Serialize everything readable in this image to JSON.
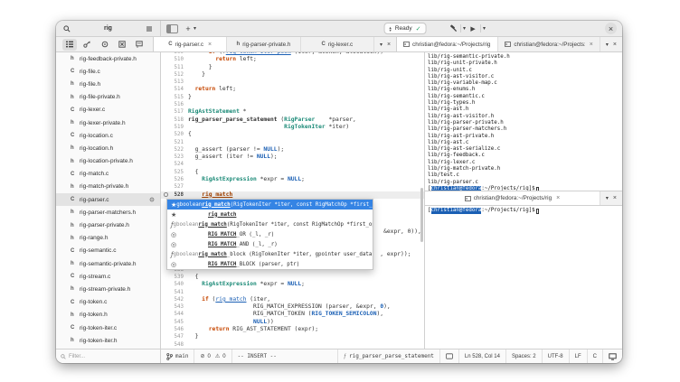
{
  "window": {
    "title": "rig"
  },
  "headerbar": {
    "ready_label": "Ready",
    "new_tab_label": "+"
  },
  "sidebar": {
    "panel_icons": [
      "project-tree",
      "symbols",
      "build-pipeline",
      "todo",
      "comments"
    ],
    "filter_placeholder": "Filter...",
    "files": [
      {
        "t": "h",
        "n": "rig-feedback-private.h"
      },
      {
        "t": "C",
        "n": "rig-file.c"
      },
      {
        "t": "h",
        "n": "rig-file.h"
      },
      {
        "t": "h",
        "n": "rig-file-private.h"
      },
      {
        "t": "C",
        "n": "rig-lexer.c"
      },
      {
        "t": "h",
        "n": "rig-lexer-private.h"
      },
      {
        "t": "C",
        "n": "rig-location.c"
      },
      {
        "t": "h",
        "n": "rig-location.h"
      },
      {
        "t": "h",
        "n": "rig-location-private.h"
      },
      {
        "t": "C",
        "n": "rig-match.c"
      },
      {
        "t": "h",
        "n": "rig-match-private.h"
      },
      {
        "t": "C",
        "n": "rig-parser.c",
        "sel": true,
        "gear": true
      },
      {
        "t": "h",
        "n": "rig-parser-matchers.h"
      },
      {
        "t": "h",
        "n": "rig-parser-private.h"
      },
      {
        "t": "h",
        "n": "rig-range.h"
      },
      {
        "t": "C",
        "n": "rig-semantic.c"
      },
      {
        "t": "h",
        "n": "rig-semantic-private.h"
      },
      {
        "t": "C",
        "n": "rig-stream.c"
      },
      {
        "t": "h",
        "n": "rig-stream-private.h"
      },
      {
        "t": "C",
        "n": "rig-token.c"
      },
      {
        "t": "h",
        "n": "rig-token.h"
      },
      {
        "t": "C",
        "n": "rig-token-iter.c"
      },
      {
        "t": "h",
        "n": "rig-token-iter.h"
      }
    ]
  },
  "editor": {
    "tabs": [
      {
        "icon": "C",
        "label": "rig-parser.c",
        "active": true,
        "close": true
      },
      {
        "icon": "h",
        "label": "rig-parser-private.h",
        "active": false,
        "close": false
      },
      {
        "icon": "C",
        "label": "rig-lexer.c",
        "active": false,
        "close": false
      }
    ],
    "lines": [
      {
        "n": 509,
        "toks": [
          [
            "pl",
            "      "
          ],
          [
            "kw",
            "if"
          ],
          [
            "pl",
            " (!"
          ],
          [
            "lnk",
            "rig_token_iter_peek"
          ],
          [
            "pl",
            " (iter, &token, &location))"
          ]
        ]
      },
      {
        "n": 510,
        "toks": [
          [
            "pl",
            "        "
          ],
          [
            "kw",
            "return"
          ],
          [
            "pl",
            " left;"
          ]
        ]
      },
      {
        "n": 511,
        "toks": [
          [
            "pl",
            "      }"
          ]
        ]
      },
      {
        "n": 512,
        "toks": [
          [
            "pl",
            "    }"
          ]
        ]
      },
      {
        "n": 513,
        "toks": []
      },
      {
        "n": 514,
        "toks": [
          [
            "pl",
            "  "
          ],
          [
            "kw",
            "return"
          ],
          [
            "pl",
            " left;"
          ]
        ]
      },
      {
        "n": 515,
        "toks": [
          [
            "pl",
            "}"
          ]
        ]
      },
      {
        "n": 516,
        "toks": []
      },
      {
        "n": 517,
        "toks": [
          [
            "ty",
            "RigAstStatement"
          ],
          [
            "pl",
            " *"
          ]
        ]
      },
      {
        "n": 518,
        "toks": [
          [
            "fn",
            "rig_parser_parse_statement"
          ],
          [
            "pl",
            " ("
          ],
          [
            "ty",
            "RigParser"
          ],
          [
            "pl",
            "    *parser,"
          ]
        ]
      },
      {
        "n": 519,
        "toks": [
          [
            "pl",
            "                            "
          ],
          [
            "ty",
            "RigTokenIter"
          ],
          [
            "pl",
            " *iter)"
          ]
        ]
      },
      {
        "n": 520,
        "toks": [
          [
            "pl",
            "{"
          ]
        ]
      },
      {
        "n": 521,
        "toks": []
      },
      {
        "n": 522,
        "toks": [
          [
            "pl",
            "  g_assert (parser != "
          ],
          [
            "ct",
            "NULL"
          ],
          [
            "pl",
            ");"
          ]
        ]
      },
      {
        "n": 523,
        "toks": [
          [
            "pl",
            "  g_assert (iter != "
          ],
          [
            "ct",
            "NULL"
          ],
          [
            "pl",
            ");"
          ]
        ]
      },
      {
        "n": 524,
        "toks": []
      },
      {
        "n": 525,
        "toks": [
          [
            "pl",
            "  {"
          ]
        ]
      },
      {
        "n": 526,
        "toks": [
          [
            "pl",
            "    "
          ],
          [
            "ty",
            "RigAstExpression"
          ],
          [
            "pl",
            " *expr = "
          ],
          [
            "ct",
            "NULL"
          ],
          [
            "pl",
            ";"
          ]
        ]
      },
      {
        "n": 527,
        "toks": []
      },
      {
        "n": 528,
        "cur": true,
        "diag": true,
        "toks": [
          [
            "pl",
            "    "
          ],
          [
            "err",
            "rig_match"
          ]
        ]
      },
      {
        "n": 529,
        "toks": []
      },
      {
        "n": 530,
        "toks": []
      },
      {
        "n": 531,
        "toks": []
      },
      {
        "n": 532,
        "toks": []
      },
      {
        "n": 533,
        "toks": [
          [
            "pl",
            "                                                         &expr, 0)),"
          ]
        ]
      },
      {
        "n": 534,
        "toks": []
      },
      {
        "n": 535,
        "toks": []
      },
      {
        "n": 536,
        "toks": [
          [
            "pl",
            "                                                        , expr));"
          ]
        ]
      },
      {
        "n": 537,
        "toks": []
      },
      {
        "n": 538,
        "toks": []
      },
      {
        "n": 539,
        "toks": [
          [
            "pl",
            "  {"
          ]
        ]
      },
      {
        "n": 540,
        "toks": [
          [
            "pl",
            "    "
          ],
          [
            "ty",
            "RigAstExpression"
          ],
          [
            "pl",
            " *expr = "
          ],
          [
            "ct",
            "NULL"
          ],
          [
            "pl",
            ";"
          ]
        ]
      },
      {
        "n": 541,
        "toks": []
      },
      {
        "n": 542,
        "toks": [
          [
            "pl",
            "    "
          ],
          [
            "kw",
            "if"
          ],
          [
            "pl",
            " ("
          ],
          [
            "lnk",
            "rig_match"
          ],
          [
            "pl",
            " (iter,"
          ]
        ]
      },
      {
        "n": 543,
        "toks": [
          [
            "pl",
            "                   RIG_MATCH_EXPRESSION (parser, &expr, "
          ],
          [
            "ct",
            "0"
          ],
          [
            "pl",
            "),"
          ]
        ]
      },
      {
        "n": 544,
        "toks": [
          [
            "pl",
            "                   RIG_MATCH_TOKEN ("
          ],
          [
            "ct",
            "RIG_TOKEN_SEMICOLON"
          ],
          [
            "pl",
            "),"
          ]
        ]
      },
      {
        "n": 545,
        "toks": [
          [
            "pl",
            "                   "
          ],
          [
            "ct",
            "NULL"
          ],
          [
            "pl",
            "))"
          ]
        ]
      },
      {
        "n": 546,
        "toks": [
          [
            "pl",
            "      "
          ],
          [
            "kw",
            "return"
          ],
          [
            "pl",
            " RIG_AST_STATEMENT (expr);"
          ]
        ]
      },
      {
        "n": 547,
        "toks": [
          [
            "pl",
            "  }"
          ]
        ]
      },
      {
        "n": 548,
        "toks": []
      },
      {
        "n": 549,
        "toks": [
          [
            "pl",
            "  {"
          ]
        ]
      }
    ]
  },
  "completion": {
    "rows": [
      {
        "icon": "star",
        "pre": "gboolean",
        "name": "rig_match",
        "post": " (RigTokenIter *iter, const RigMatchOp *first_op, ...)",
        "sel": true
      },
      {
        "icon": "star",
        "pre": "",
        "name": "rig_match",
        "post": ""
      },
      {
        "icon": "func",
        "pre": "gboolean",
        "name": "rig_match",
        "post": " (RigTokenIter *iter, const RigMatchOp *first_op, ...)"
      },
      {
        "icon": "macro",
        "pre": "",
        "name": "RIG_MATCH",
        "post": "_OR (_l, _r)"
      },
      {
        "icon": "macro",
        "pre": "",
        "name": "RIG_MATCH",
        "post": "_AND (_l, _r)"
      },
      {
        "icon": "func",
        "pre": "gboolean",
        "name": "rig_match",
        "post": "_block (RigTokenIter *iter, gpointer user_data)"
      },
      {
        "icon": "macro",
        "pre": "",
        "name": "RIG_MATCH",
        "post": "_BLOCK (parser, ptr)"
      }
    ]
  },
  "terminal_panel": {
    "tabs_top": [
      {
        "label": "christian@fedora:~/Projects/rig",
        "active": true,
        "close": false
      },
      {
        "label": "christian@fedora:~/Projects:",
        "active": false,
        "close": true
      }
    ],
    "tab_bottom": {
      "label": "christian@fedora:~/Projects/rig",
      "close": true
    },
    "term1_lines": [
      "lib/rig-semantic-private.h",
      "lib/rig-unit-private.h",
      "lib/rig-unit.c",
      "lib/rig-ast-visitor.c",
      "lib/rig-variable-map.c",
      "lib/rig-enums.h",
      "lib/rig-semantic.c",
      "lib/rig-types.h",
      "lib/rig-ast.h",
      "lib/rig-ast-visitor.h",
      "lib/rig-parser-private.h",
      "lib/rig-parser-matchers.h",
      "lib/rig-ast-private.h",
      "lib/rig-ast.c",
      "lib/rig-ast-serialize.c",
      "lib/rig-feedback.c",
      "lib/rig-lexer.c",
      "lib/rig-match-private.h",
      "lib/test.c",
      "lib/rig-parser.c"
    ],
    "prompt": {
      "open": "[",
      "user": "christian@fedora",
      "path": ":~/Projects/rig]$",
      "trail": " "
    }
  },
  "statusbar": {
    "branch": "main",
    "errors": "0",
    "warnings": "0",
    "mode": "-- INSERT --",
    "symbol": "rig_parser_parse_statement",
    "position": "Ln 528, Col 14",
    "indent": "Spaces: 2",
    "encoding": "UTF-8",
    "eol": "LF",
    "language": "C"
  },
  "colors": {
    "accent": "#3584e4",
    "selection_blue": "#1a5fb4",
    "keyword": "#c64600",
    "type": "#1b8a77",
    "constant": "#1a5fb4",
    "header_bg": "#ebebeb"
  }
}
